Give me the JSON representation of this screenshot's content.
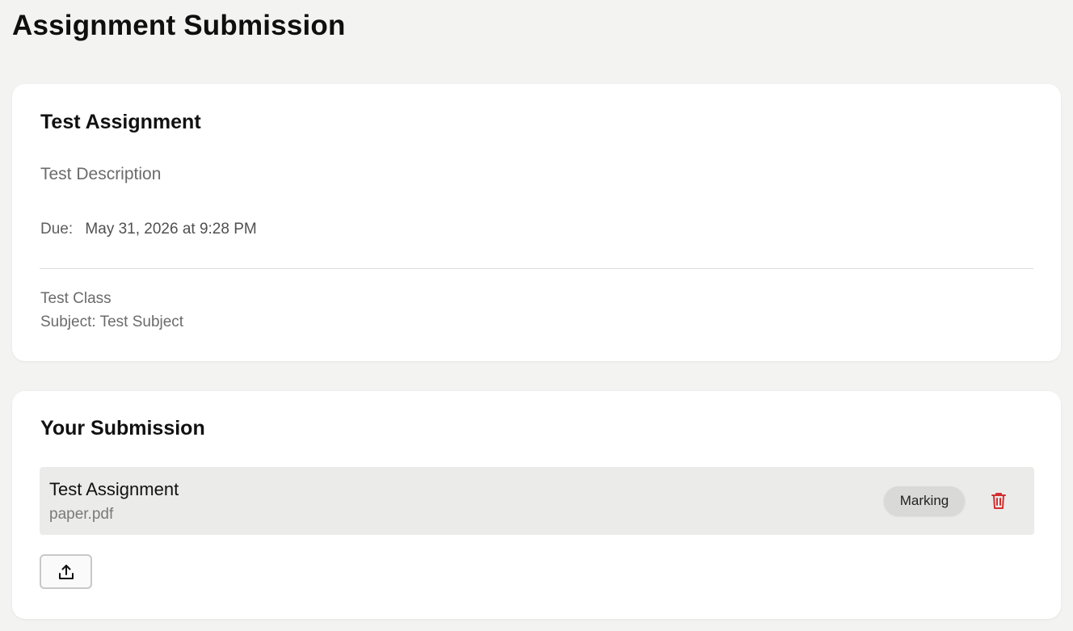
{
  "page": {
    "title": "Assignment Submission"
  },
  "assignment": {
    "title": "Test Assignment",
    "description": "Test Description",
    "due_label": "Due:",
    "due_value": "May 31, 2026 at 9:28 PM",
    "class_name": "Test Class",
    "subject_line": "Subject: Test Subject"
  },
  "submission": {
    "heading": "Your Submission",
    "items": [
      {
        "title": "Test Assignment",
        "file_name": "paper.pdf",
        "status": "Marking",
        "delete_icon": "trash-icon"
      }
    ],
    "upload_icon": "upload-icon"
  },
  "colors": {
    "background": "#f3f3f2",
    "card": "#ffffff",
    "row_background": "#ebebea",
    "badge_background": "#d9d9d8",
    "delete_red": "#d32f2f",
    "muted_text": "#6b6b6b"
  }
}
